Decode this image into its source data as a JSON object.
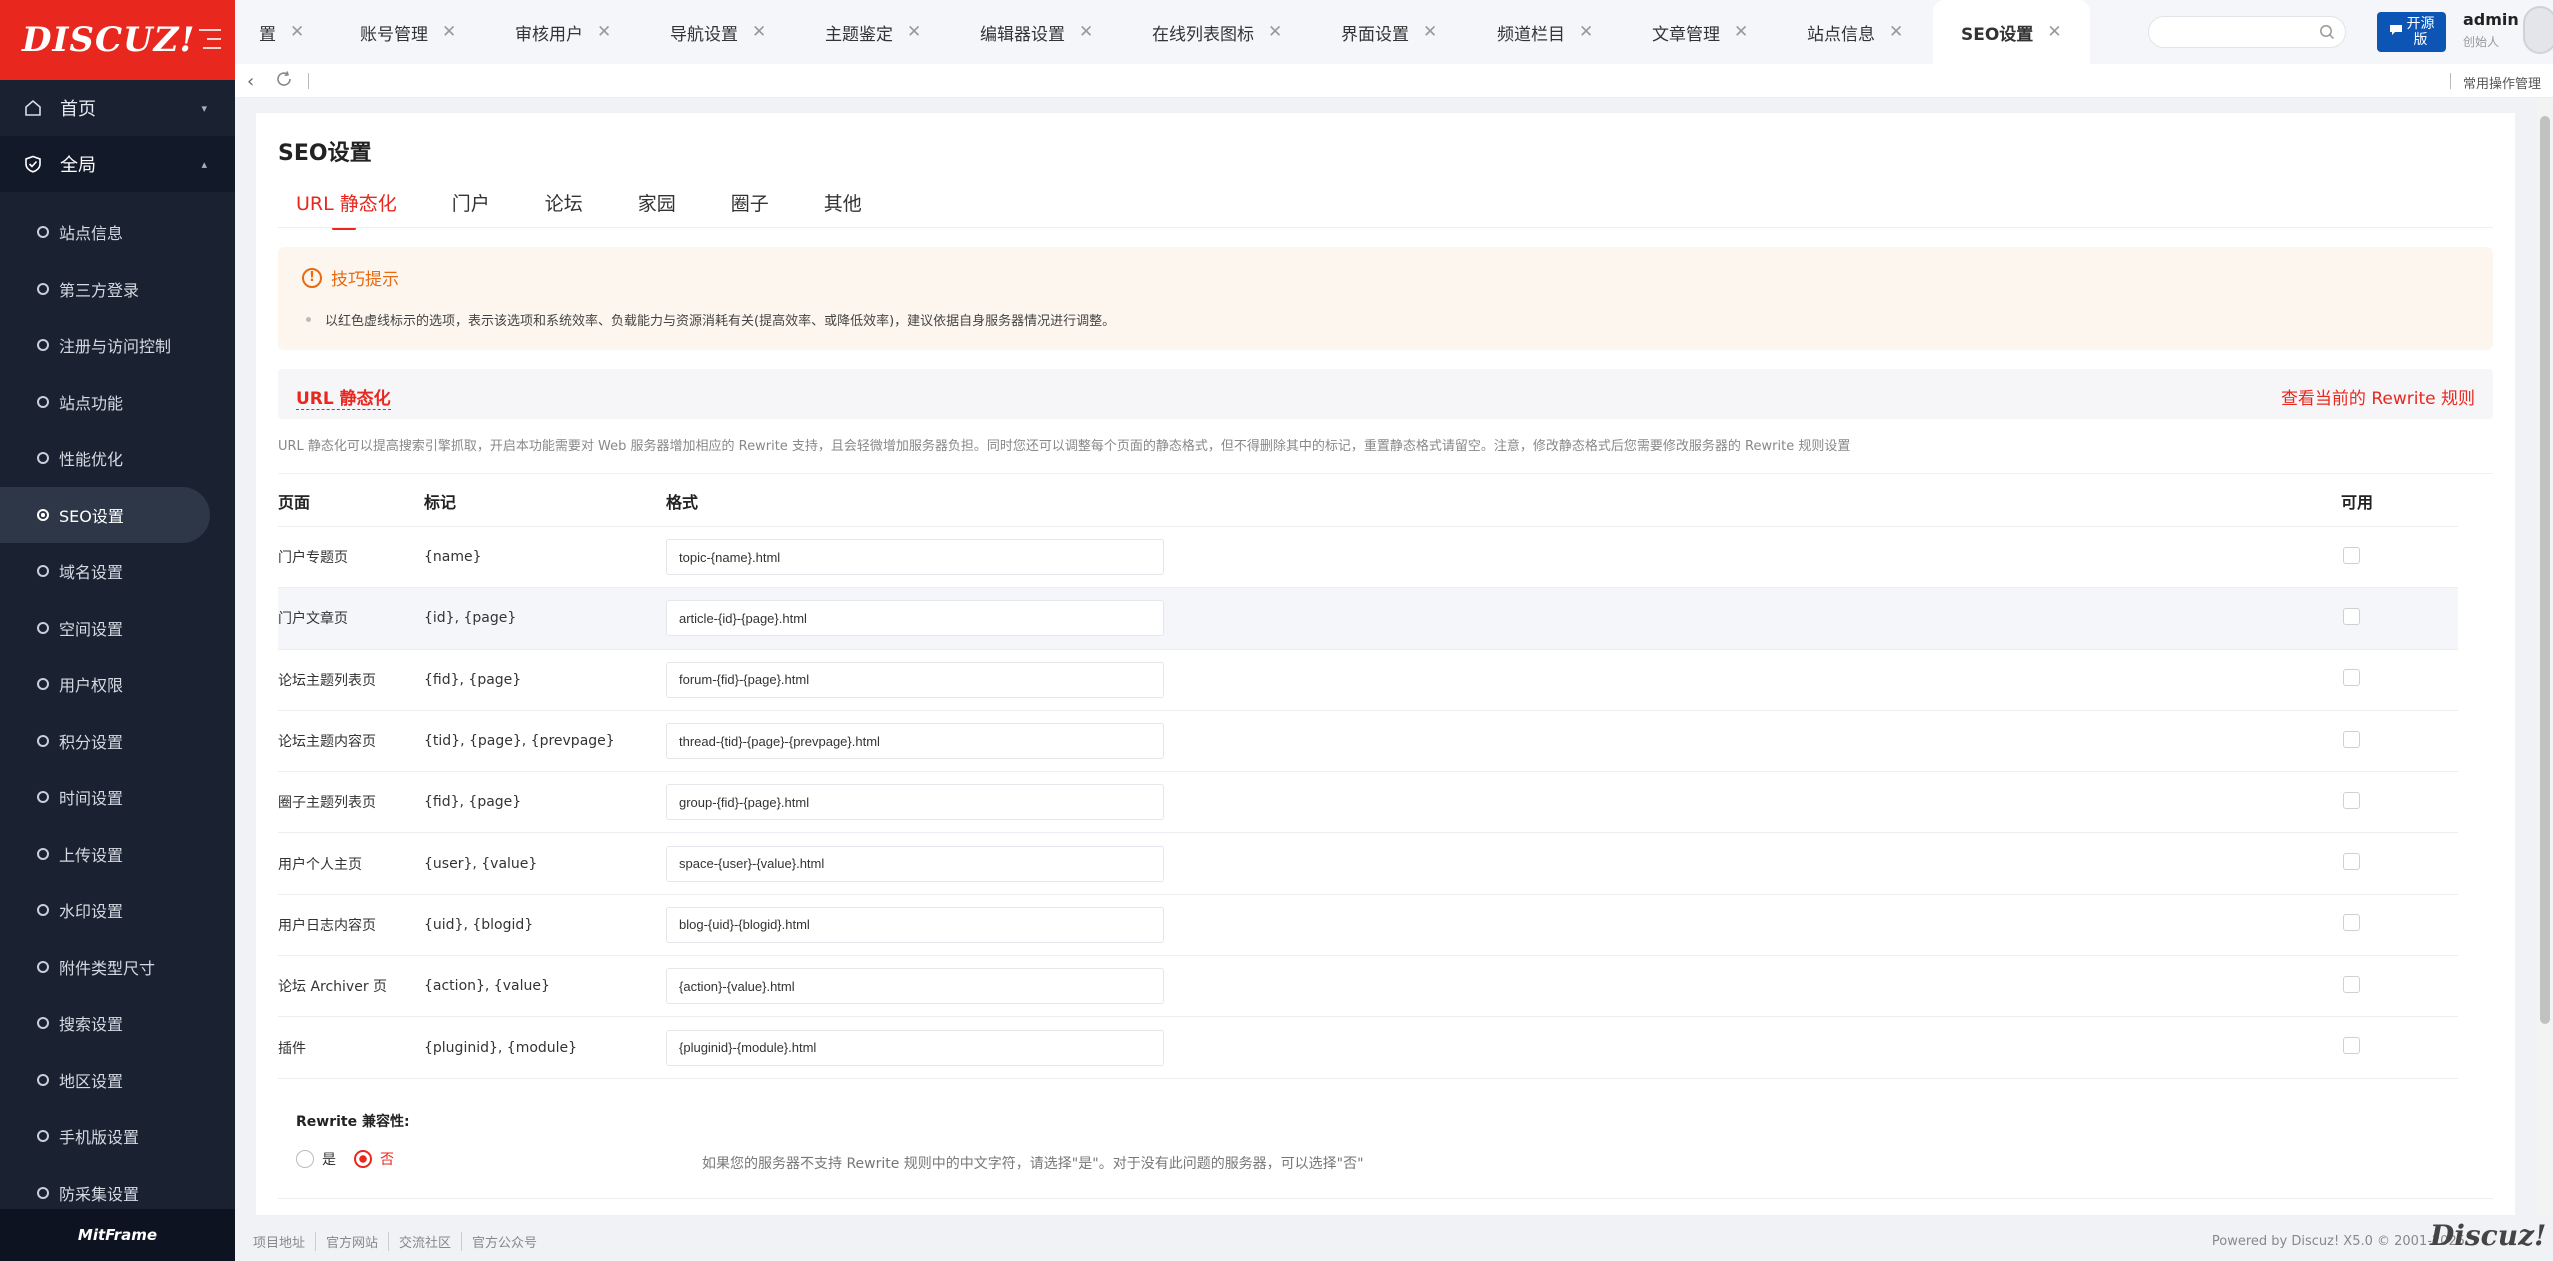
{
  "brand": {
    "logo_text": "DISCUZ!"
  },
  "sidebar": {
    "top_items": [
      {
        "label": "首页",
        "expanded": false
      },
      {
        "label": "全局",
        "expanded": true
      }
    ],
    "sub_items": [
      {
        "label": "站点信息"
      },
      {
        "label": "第三方登录"
      },
      {
        "label": "注册与访问控制"
      },
      {
        "label": "站点功能"
      },
      {
        "label": "性能优化"
      },
      {
        "label": "SEO设置",
        "active": true
      },
      {
        "label": "域名设置"
      },
      {
        "label": "空间设置"
      },
      {
        "label": "用户权限"
      },
      {
        "label": "积分设置"
      },
      {
        "label": "时间设置"
      },
      {
        "label": "上传设置"
      },
      {
        "label": "水印设置"
      },
      {
        "label": "附件类型尺寸"
      },
      {
        "label": "搜索设置"
      },
      {
        "label": "地区设置"
      },
      {
        "label": "手机版设置"
      },
      {
        "label": "防采集设置"
      }
    ],
    "footer_text": "MitFrame"
  },
  "tabs": [
    {
      "label": "置"
    },
    {
      "label": "账号管理"
    },
    {
      "label": "审核用户"
    },
    {
      "label": "导航设置"
    },
    {
      "label": "主题鉴定"
    },
    {
      "label": "编辑器设置"
    },
    {
      "label": "在线列表图标"
    },
    {
      "label": "界面设置"
    },
    {
      "label": "频道栏目"
    },
    {
      "label": "文章管理"
    },
    {
      "label": "站点信息"
    },
    {
      "label": "SEO设置",
      "active": true
    }
  ],
  "header": {
    "search_placeholder": "",
    "open_button": {
      "line1": "开源",
      "line2": "版"
    },
    "user": {
      "name": "admin",
      "role": "创始人"
    }
  },
  "toolbar": {
    "shortcut_label": "常用操作管理"
  },
  "page": {
    "title": "SEO设置",
    "subtabs": [
      {
        "label": "URL 静态化",
        "active": true
      },
      {
        "label": "门户"
      },
      {
        "label": "论坛"
      },
      {
        "label": "家园"
      },
      {
        "label": "圈子"
      },
      {
        "label": "其他"
      }
    ],
    "tip": {
      "title": "技巧提示",
      "text": "以红色虚线标示的选项，表示该选项和系统效率、负载能力与资源消耗有关(提高效率、或降低效率)，建议依据自身服务器情况进行调整。"
    },
    "section": {
      "title": "URL 静态化",
      "link": "查看当前的 Rewrite 规则",
      "desc": "URL 静态化可以提高搜索引擎抓取，开启本功能需要对 Web 服务器增加相应的 Rewrite 支持，且会轻微增加服务器负担。同时您还可以调整每个页面的静态格式，但不得删除其中的标记，重置静态格式请留空。注意，修改静态格式后您需要修改服务器的 Rewrite 规则设置"
    },
    "table": {
      "headers": {
        "page": "页面",
        "mark": "标记",
        "format": "格式",
        "enabled": "可用"
      },
      "rows": [
        {
          "page": "门户专题页",
          "mark": "{name}",
          "format": "topic-{name}.html",
          "enabled": false
        },
        {
          "page": "门户文章页",
          "mark": "{id}, {page}",
          "format": "article-{id}-{page}.html",
          "enabled": false
        },
        {
          "page": "论坛主题列表页",
          "mark": "{fid}, {page}",
          "format": "forum-{fid}-{page}.html",
          "enabled": false
        },
        {
          "page": "论坛主题内容页",
          "mark": "{tid}, {page}, {prevpage}",
          "format": "thread-{tid}-{page}-{prevpage}.html",
          "enabled": false
        },
        {
          "page": "圈子主题列表页",
          "mark": "{fid}, {page}",
          "format": "group-{fid}-{page}.html",
          "enabled": false
        },
        {
          "page": "用户个人主页",
          "mark": "{user}, {value}",
          "format": "space-{user}-{value}.html",
          "enabled": false
        },
        {
          "page": "用户日志内容页",
          "mark": "{uid}, {blogid}",
          "format": "blog-{uid}-{blogid}.html",
          "enabled": false
        },
        {
          "page": "论坛 Archiver 页",
          "mark": "{action}, {value}",
          "format": "{action}-{value}.html",
          "enabled": false
        },
        {
          "page": "插件",
          "mark": "{pluginid}, {module}",
          "format": "{pluginid}-{module}.html",
          "enabled": false
        }
      ]
    },
    "rewrite": {
      "label": "Rewrite 兼容性:",
      "option_yes": "是",
      "option_no": "否",
      "selected": "否",
      "hint": "如果您的服务器不支持 Rewrite 规则中的中文字符，请选择\"是\"。对于没有此问题的服务器，可以选择\"否\""
    }
  },
  "footer": {
    "links": [
      "项目地址",
      "官方网站",
      "交流社区",
      "官方公众号"
    ],
    "powered": "Powered by Discuz! X5.0 © 2001-2025",
    "watermark": "Discuz!"
  },
  "colors": {
    "brand_red": "#e8281f",
    "sidebar_bg": "#1a2232",
    "tip_orange": "#e86a12",
    "open_button_blue": "#0c55b5"
  }
}
